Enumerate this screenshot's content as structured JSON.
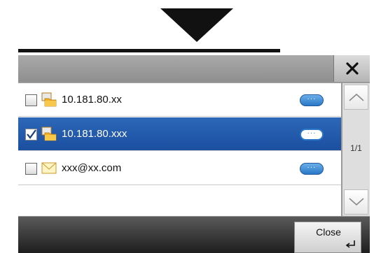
{
  "dialog": {
    "close_icon": "close-x-icon",
    "rows": [
      {
        "label": "10.181.80.xx",
        "type": "folder",
        "checked": false,
        "selected": false
      },
      {
        "label": "10.181.80.xxx",
        "type": "folder",
        "checked": true,
        "selected": true
      },
      {
        "label": "xxx@xx.com",
        "type": "email",
        "checked": false,
        "selected": false
      }
    ],
    "pager": {
      "indicator": "1/1"
    },
    "footer": {
      "close_label": "Close"
    }
  },
  "colors": {
    "selected_row": "#1b4fa0",
    "detail_button": "#2a78c7",
    "header": "#9a9a9a",
    "footer": "#1e1e1e"
  }
}
